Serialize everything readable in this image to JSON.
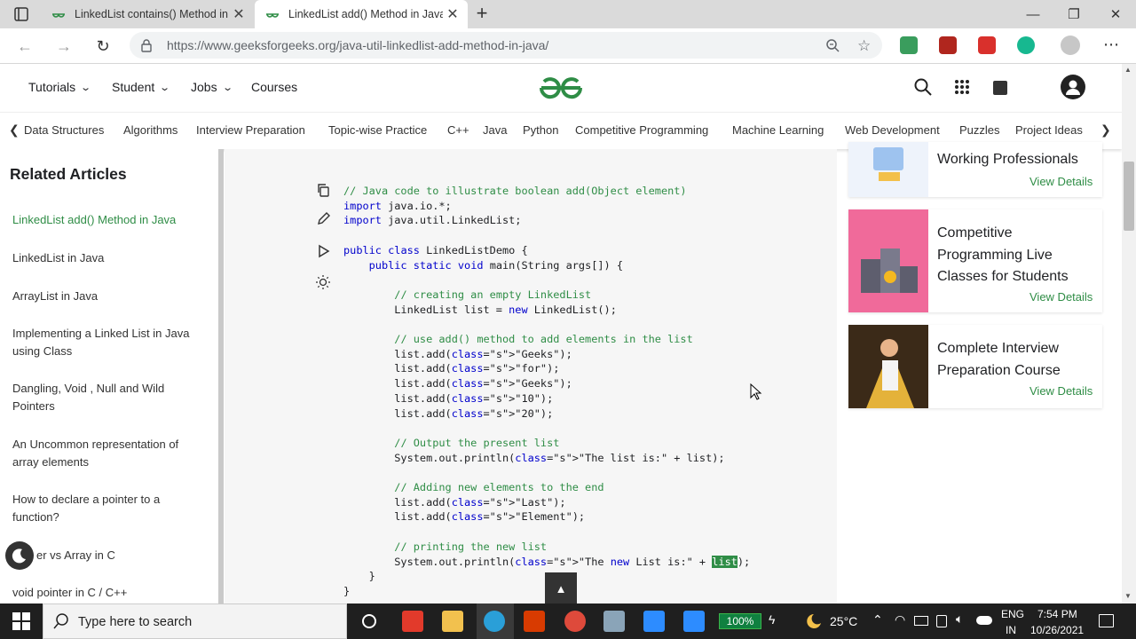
{
  "browser": {
    "tabs": [
      {
        "label": "LinkedList contains() Method in J",
        "active": false
      },
      {
        "label": "LinkedList add() Method in Java",
        "active": true
      }
    ],
    "url": "https://www.geeksforgeeks.org/java-util-linkedlist-add-method-in-java/"
  },
  "site": {
    "nav": [
      "Tutorials",
      "Student",
      "Jobs",
      "Courses"
    ],
    "categories": [
      "Data Structures",
      "Algorithms",
      "Interview Preparation",
      "Topic-wise Practice",
      "C++",
      "Java",
      "Python",
      "Competitive Programming",
      "Machine Learning",
      "Web Development",
      "Puzzles",
      "Project Ideas"
    ],
    "brand_color": "#2f8d46"
  },
  "sidebar": {
    "title": "Related Articles",
    "items": [
      "LinkedList add() Method in Java",
      "LinkedList in Java",
      "ArrayList in Java",
      "Implementing a Linked List in Java using Class",
      "Dangling, Void , Null and Wild Pointers",
      "An Uncommon representation of array elements",
      "How to declare a pointer to a function?",
      "er vs Array in C",
      "void pointer in C / C++"
    ]
  },
  "code": {
    "lines": [
      "// Java code to illustrate boolean add(Object element)",
      "import java.io.*;",
      "import java.util.LinkedList;",
      "",
      "public class LinkedListDemo {",
      "    public static void main(String args[]) {",
      "",
      "        // creating an empty LinkedList",
      "        LinkedList list = new LinkedList();",
      "",
      "        // use add() method to add elements in the list",
      "        list.add(\"Geeks\");",
      "        list.add(\"for\");",
      "        list.add(\"Geeks\");",
      "        list.add(\"10\");",
      "        list.add(\"20\");",
      "",
      "        // Output the present list",
      "        System.out.println(\"The list is:\" + list);",
      "",
      "        // Adding new elements to the end",
      "        list.add(\"Last\");",
      "        list.add(\"Element\");",
      "",
      "        // printing the new list",
      "        System.out.println(\"The new List is:\" + list);",
      "    }",
      "}"
    ],
    "highlighted_word": "list"
  },
  "cards": [
    {
      "title": "Working Professionals",
      "link": "View Details"
    },
    {
      "title": "Competitive Programming Live Classes for Students",
      "link": "View Details"
    },
    {
      "title": "Complete Interview Preparation Course",
      "link": "View Details"
    }
  ],
  "taskbar": {
    "search_placeholder": "Type here to search",
    "battery": "100%",
    "temperature": "25°C",
    "language": "ENG",
    "region": "IN",
    "time": "7:54 PM",
    "date": "10/26/2021"
  }
}
